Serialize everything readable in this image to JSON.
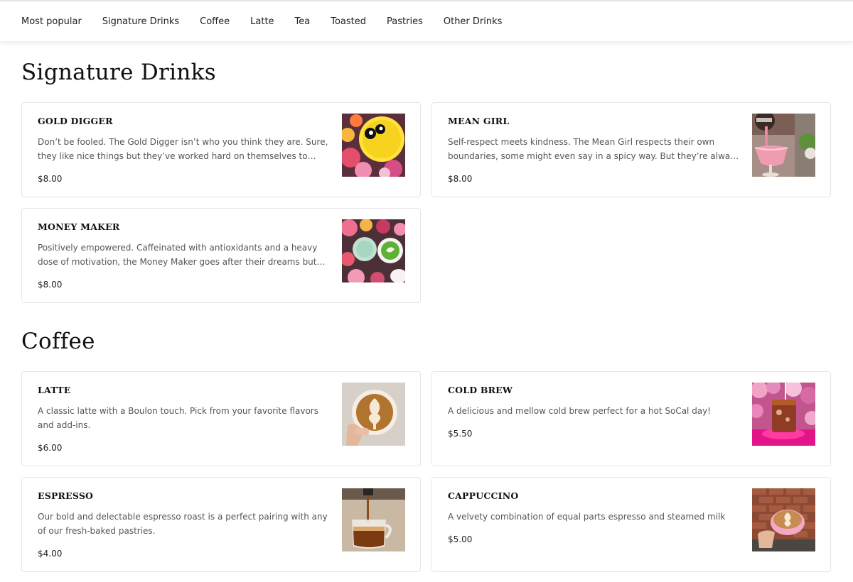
{
  "nav": {
    "items": [
      "Most popular",
      "Signature Drinks",
      "Coffee",
      "Latte",
      "Tea",
      "Toasted",
      "Pastries",
      "Other Drinks"
    ]
  },
  "sections": [
    {
      "title": "Signature Drinks",
      "items": [
        {
          "name": "GOLD DIGGER",
          "description": "Don’t be fooled. The Gold Digger isn’t who you think they are. Sure, they like nice things but they’ve worked hard on themselves to achieve their goals.",
          "price": "$8.00",
          "image": "gold-digger-drink-photo"
        },
        {
          "name": "MEAN GIRL",
          "description": "Self-respect meets kindness. The Mean Girl respects their own boundaries, some might even say in a spicy way. But they’re always kind at heart.",
          "price": "$8.00",
          "image": "mean-girl-drink-photo"
        },
        {
          "name": "MONEY MAKER",
          "description": "Positively empowered. Caffeinated with antioxidants and a heavy dose of motivation, the Money Maker goes after their dreams but never gives up.",
          "price": "$8.00",
          "image": "money-maker-drink-photo"
        }
      ]
    },
    {
      "title": "Coffee",
      "items": [
        {
          "name": "LATTE",
          "description": "A classic latte with a Boulon touch. Pick from your favorite flavors and add-ins.",
          "price": "$6.00",
          "image": "latte-photo"
        },
        {
          "name": "COLD BREW",
          "description": "A delicious and mellow cold brew perfect for a hot SoCal day!",
          "price": "$5.50",
          "image": "cold-brew-photo"
        },
        {
          "name": "ESPRESSO",
          "description": "Our bold and delectable espresso roast is a perfect pairing with any of our fresh-baked pastries.",
          "price": "$4.00",
          "image": "espresso-photo"
        },
        {
          "name": "CAPPUCCINO",
          "description": "A velvety combination of equal parts espresso and steamed milk",
          "price": "$5.00",
          "image": "cappuccino-photo"
        }
      ]
    }
  ]
}
